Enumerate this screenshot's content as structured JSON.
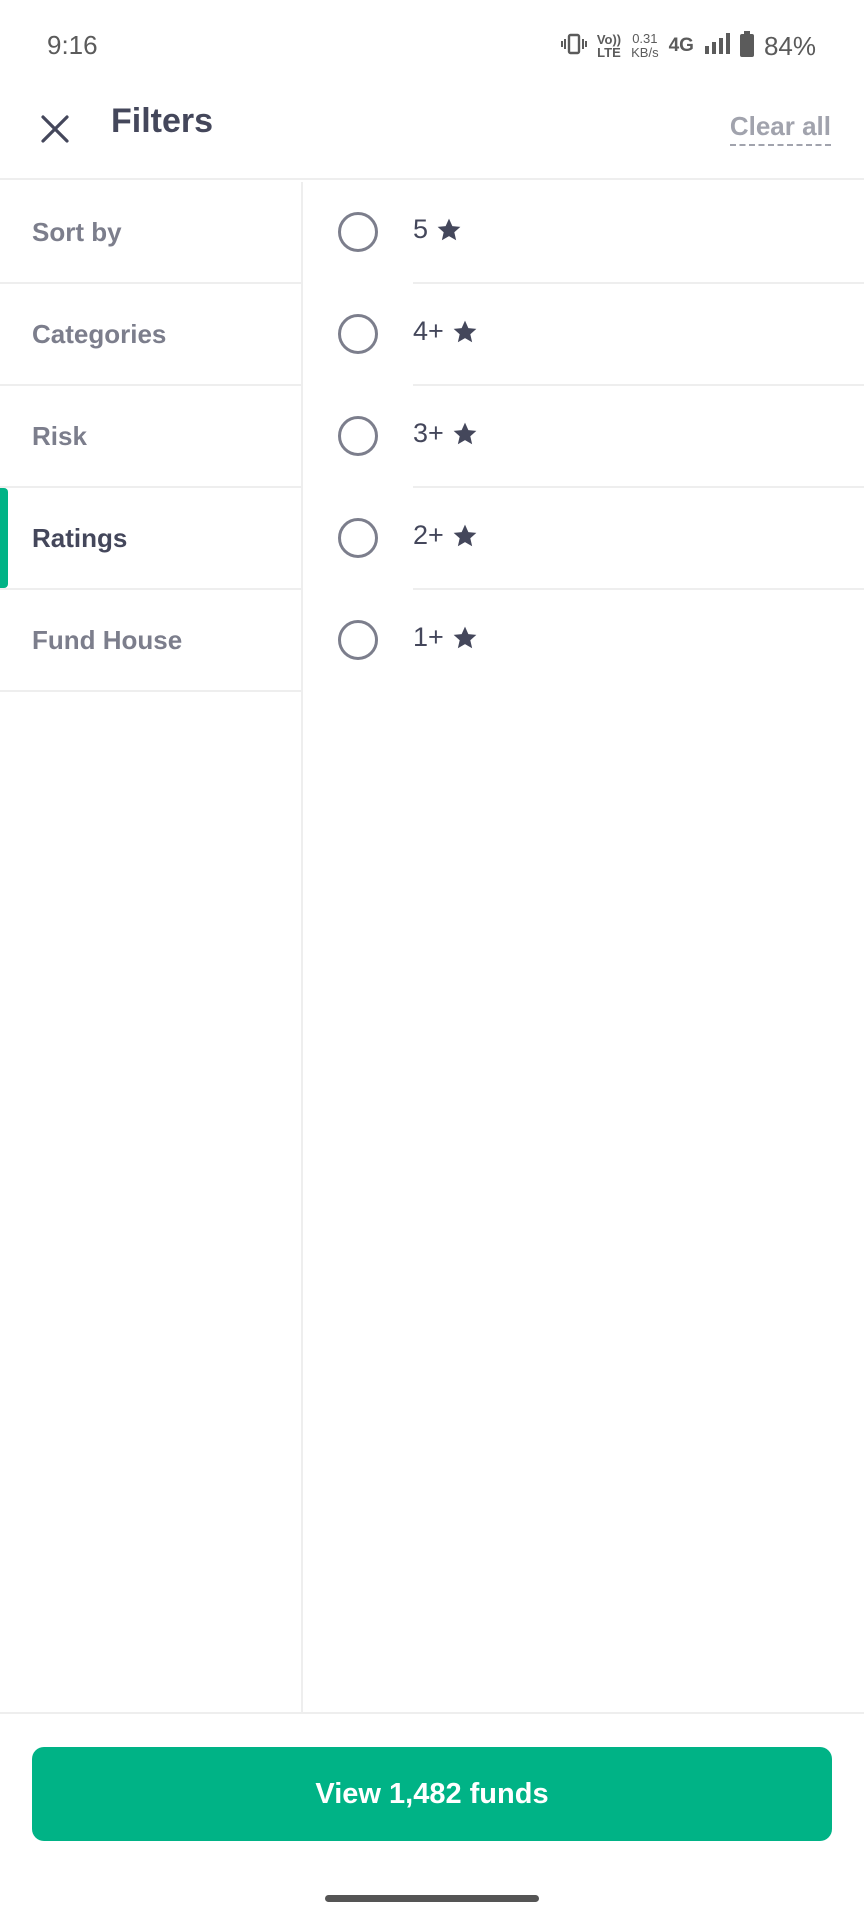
{
  "status_bar": {
    "time": "9:16",
    "volte_top": "Vo))",
    "volte_bottom": "LTE",
    "speed_value": "0.31",
    "speed_unit": "KB/s",
    "network": "4G",
    "battery_percent": "84%",
    "icons": [
      "vibrate-icon",
      "signal-icon",
      "battery-icon"
    ]
  },
  "header": {
    "title": "Filters",
    "clear_all": "Clear all",
    "close_icon": "close-icon"
  },
  "menu": {
    "items": [
      {
        "label": "Sort by"
      },
      {
        "label": "Categories"
      },
      {
        "label": "Risk"
      },
      {
        "label": "Ratings"
      },
      {
        "label": "Fund House"
      }
    ],
    "active": "Ratings"
  },
  "ratings": {
    "options": [
      {
        "label": "5",
        "selected": false
      },
      {
        "label": "4+",
        "selected": false
      },
      {
        "label": "3+",
        "selected": false
      },
      {
        "label": "2+",
        "selected": false
      },
      {
        "label": "1+",
        "selected": false
      }
    ],
    "star_icon": "star-icon"
  },
  "footer": {
    "button_label": "View 1,482 funds"
  },
  "colors": {
    "accent": "#00b386",
    "text_primary": "#44475b",
    "text_secondary": "#7c7e8c",
    "text_muted": "#a1a3ad",
    "divider": "#eeeeee"
  }
}
